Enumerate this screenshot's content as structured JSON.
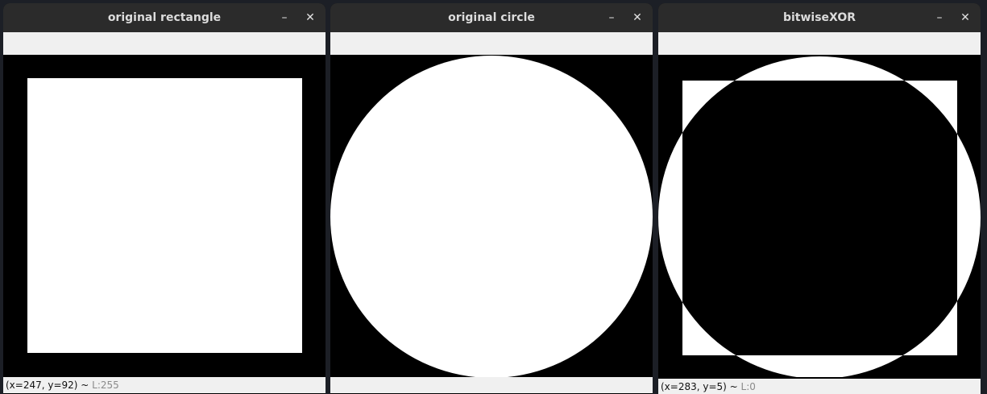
{
  "windows": [
    {
      "title": "original rectangle",
      "min_icon": "minimize-icon",
      "close_icon": "close-icon",
      "status_coords": "(x=247, y=92) ~ ",
      "status_level": "L:255"
    },
    {
      "title": "original circle",
      "min_icon": "minimize-icon",
      "close_icon": "close-icon",
      "status_coords": "",
      "status_level": ""
    },
    {
      "title": "bitwiseXOR",
      "min_icon": "minimize-icon",
      "close_icon": "close-icon",
      "status_coords": "(x=283, y=5) ~ ",
      "status_level": "L:0"
    }
  ],
  "glyphs": {
    "minimize": "–",
    "close": "✕"
  },
  "colors": {
    "titlebar": "#2b2b2b",
    "toolbar": "#f0f0f0",
    "canvas": "#000000",
    "shape": "#ffffff"
  }
}
